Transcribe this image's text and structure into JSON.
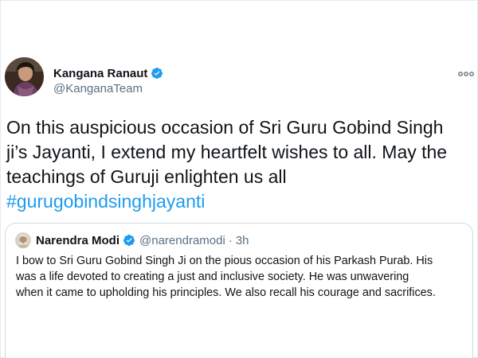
{
  "tweet": {
    "author": {
      "display_name": "Kangana Ranaut",
      "handle": "@KanganaTeam",
      "verified": true
    },
    "body_lines": [
      "On this auspicious occasion of Sri Guru Gobind Singh",
      "ji’s Jayanti, I extend my heartfelt wishes to all. May the",
      "teachings of Guruji enlighten us all"
    ],
    "hashtag": "#gurugobindsinghjayanti",
    "more_icon": "more-horizontal-icon",
    "quoted": {
      "display_name": "Narendra Modi",
      "handle": "@narendramodi",
      "separator": "·",
      "time": "3h",
      "verified": true,
      "text_lines": [
        "I bow to Sri Guru Gobind Singh Ji on the pious occasion of his Parkash Purab. His",
        "was a life devoted to creating a just and inclusive society. He was unwavering",
        "when it came to upholding his principles. We also recall his courage and sacrifices."
      ]
    }
  },
  "colors": {
    "text": "#0f1419",
    "secondary": "#5b7083",
    "accent": "#1d9bf0",
    "border": "#cfd9de"
  }
}
